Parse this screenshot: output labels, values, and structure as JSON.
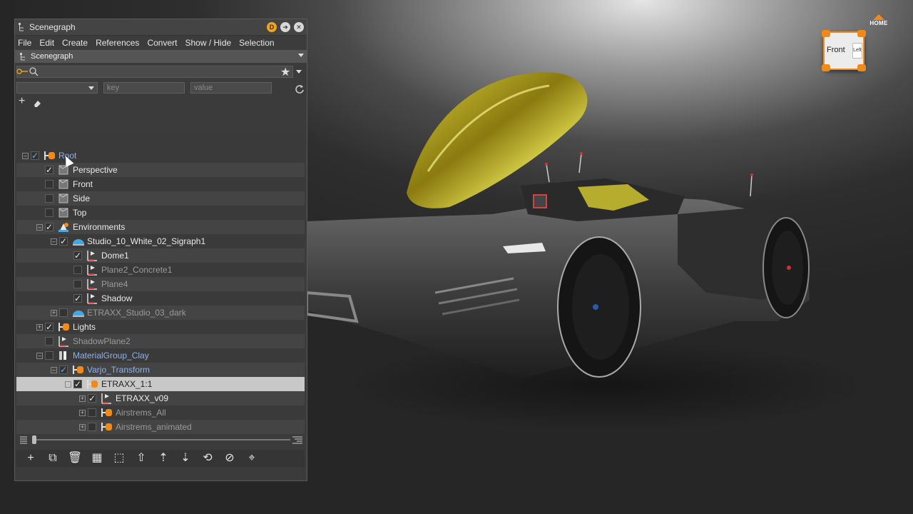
{
  "window": {
    "title": "Scenegraph",
    "badge": "D"
  },
  "menu": [
    "File",
    "Edit",
    "Create",
    "References",
    "Convert",
    "Show / Hide",
    "Selection"
  ],
  "breadcrumb": "Scenegraph",
  "search": {
    "placeholder": ""
  },
  "filter": {
    "key_placeholder": "key",
    "value_placeholder": "value"
  },
  "tree": [
    {
      "label": "Root",
      "depth": 0,
      "checked": true,
      "expander": "-",
      "icon": "transform-node-icon",
      "style": "blue"
    },
    {
      "label": "Perspective",
      "depth": 1,
      "checked": true,
      "expander": "",
      "icon": "camera-icon",
      "style": "normal"
    },
    {
      "label": "Front",
      "depth": 1,
      "checked": false,
      "expander": "",
      "icon": "camera-icon",
      "style": "normal"
    },
    {
      "label": "Side",
      "depth": 1,
      "checked": false,
      "expander": "",
      "icon": "camera-icon",
      "style": "normal"
    },
    {
      "label": "Top",
      "depth": 1,
      "checked": false,
      "expander": "",
      "icon": "camera-icon",
      "style": "normal"
    },
    {
      "label": "Environments",
      "depth": 1,
      "checked": true,
      "expander": "-",
      "icon": "environment-icon",
      "style": "normal"
    },
    {
      "label": "Studio_10_White_02_Sigraph1",
      "depth": 2,
      "checked": true,
      "expander": "-",
      "icon": "dome-icon",
      "style": "normal"
    },
    {
      "label": "Dome1",
      "depth": 3,
      "checked": true,
      "expander": "",
      "icon": "geometry-icon",
      "style": "normal"
    },
    {
      "label": "Plane2_Concrete1",
      "depth": 3,
      "checked": false,
      "expander": "",
      "icon": "geometry-icon",
      "style": "dim"
    },
    {
      "label": "Plane4",
      "depth": 3,
      "checked": false,
      "expander": "",
      "icon": "geometry-icon",
      "style": "dim"
    },
    {
      "label": "Shadow",
      "depth": 3,
      "checked": true,
      "expander": "",
      "icon": "geometry-icon",
      "style": "normal"
    },
    {
      "label": "ETRAXX_Studio_03_dark",
      "depth": 2,
      "checked": false,
      "expander": "+",
      "icon": "dome-icon",
      "style": "dim"
    },
    {
      "label": "Lights",
      "depth": 1,
      "checked": true,
      "expander": "+",
      "icon": "transform-node-icon",
      "style": "normal"
    },
    {
      "label": "ShadowPlane2",
      "depth": 1,
      "checked": false,
      "expander": "",
      "icon": "geometry-icon",
      "style": "dim"
    },
    {
      "label": "MaterialGroup_Clay",
      "depth": 1,
      "checked": false,
      "expander": "-",
      "icon": "material-group-icon",
      "style": "blue"
    },
    {
      "label": "Varjo_Transform",
      "depth": 2,
      "checked": true,
      "expander": "-",
      "icon": "transform-node-icon",
      "style": "blue"
    },
    {
      "label": "ETRAXX_1:1",
      "depth": 3,
      "checked": true,
      "expander": "-",
      "icon": "transform-node-icon",
      "style": "selected"
    },
    {
      "label": "ETRAXX_v09",
      "depth": 4,
      "checked": true,
      "expander": "+",
      "icon": "geometry-icon",
      "style": "normal"
    },
    {
      "label": "Airstrems_All",
      "depth": 4,
      "checked": false,
      "expander": "+",
      "icon": "transform-node-icon",
      "style": "dim"
    },
    {
      "label": "Airstrems_animated",
      "depth": 4,
      "checked": false,
      "expander": "+",
      "icon": "transform-node-icon",
      "style": "dim"
    }
  ],
  "toolbar": [
    "add-node-icon",
    "group-icon",
    "delete-icon",
    "select-grid-icon",
    "select-region-icon",
    "move-up-icon",
    "sort-up-icon",
    "sort-down-icon",
    "convert-icon",
    "hide-icon",
    "pin-node-icon"
  ],
  "navcube": {
    "front_label": "Front",
    "side_label": "Left",
    "home_label": "HOME"
  },
  "colors": {
    "accent": "#f08a1a",
    "selection": "#c8c8c8",
    "link_blue": "#8fb2ea"
  }
}
